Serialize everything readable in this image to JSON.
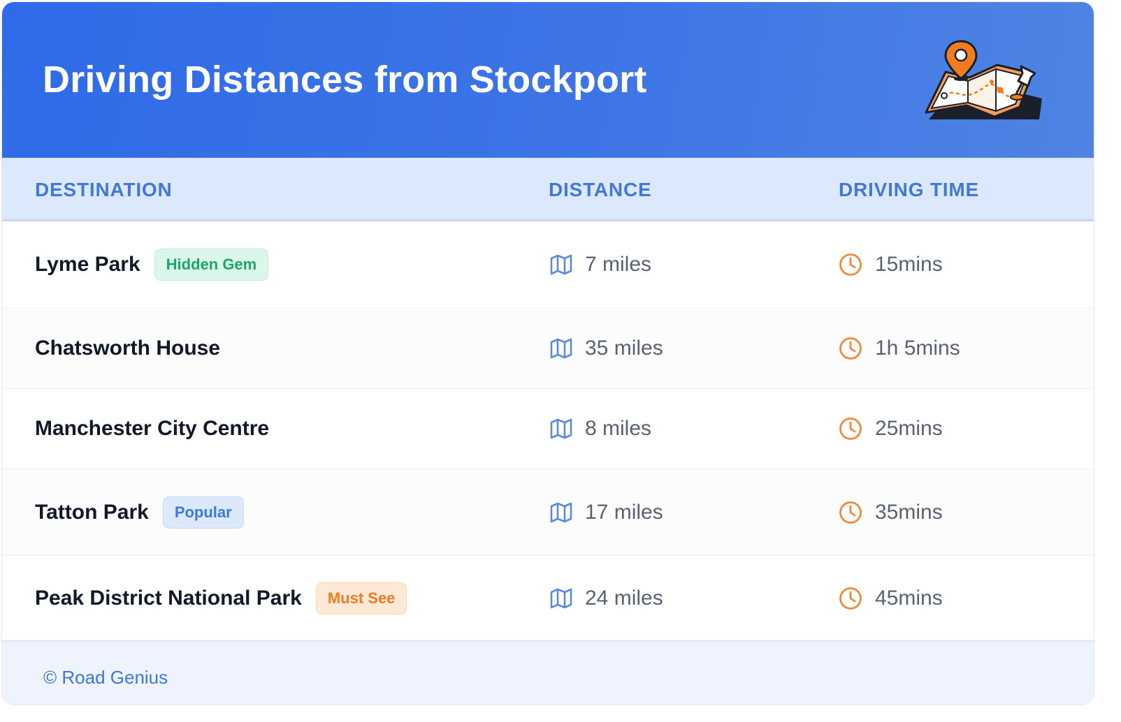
{
  "header": {
    "title": "Driving Distances from Stockport",
    "illustration": "map-with-pins-illustration",
    "colors": {
      "gradient_start": "#2f6be8",
      "gradient_end": "#4f84e4"
    }
  },
  "columns": {
    "destination": "DESTINATION",
    "distance": "DISTANCE",
    "driving_time": "DRIVING TIME"
  },
  "rows": [
    {
      "destination": "Lyme Park",
      "badge": "Hidden Gem",
      "badge_color": "green",
      "distance": "7 miles",
      "time": "15mins"
    },
    {
      "destination": "Chatsworth House",
      "badge": "",
      "badge_color": "",
      "distance": "35 miles",
      "time": "1h 5mins"
    },
    {
      "destination": "Manchester City Centre",
      "badge": "",
      "badge_color": "",
      "distance": "8 miles",
      "time": "25mins"
    },
    {
      "destination": "Tatton Park",
      "badge": "Popular",
      "badge_color": "blue",
      "distance": "17 miles",
      "time": "35mins"
    },
    {
      "destination": "Peak District National Park",
      "badge": "Must See",
      "badge_color": "orange",
      "distance": "24 miles",
      "time": "45mins"
    }
  ],
  "icons": {
    "distance": "map-icon",
    "time": "clock-icon"
  },
  "footer": {
    "text": "© Road Genius"
  },
  "theme": {
    "accent": "#3e79d9",
    "map_icon_color": "#5b8ad8",
    "clock_icon_color": "#ef8a3c",
    "badge_green": "#19a865",
    "badge_blue": "#3e79d9",
    "badge_orange": "#ef7c21"
  }
}
